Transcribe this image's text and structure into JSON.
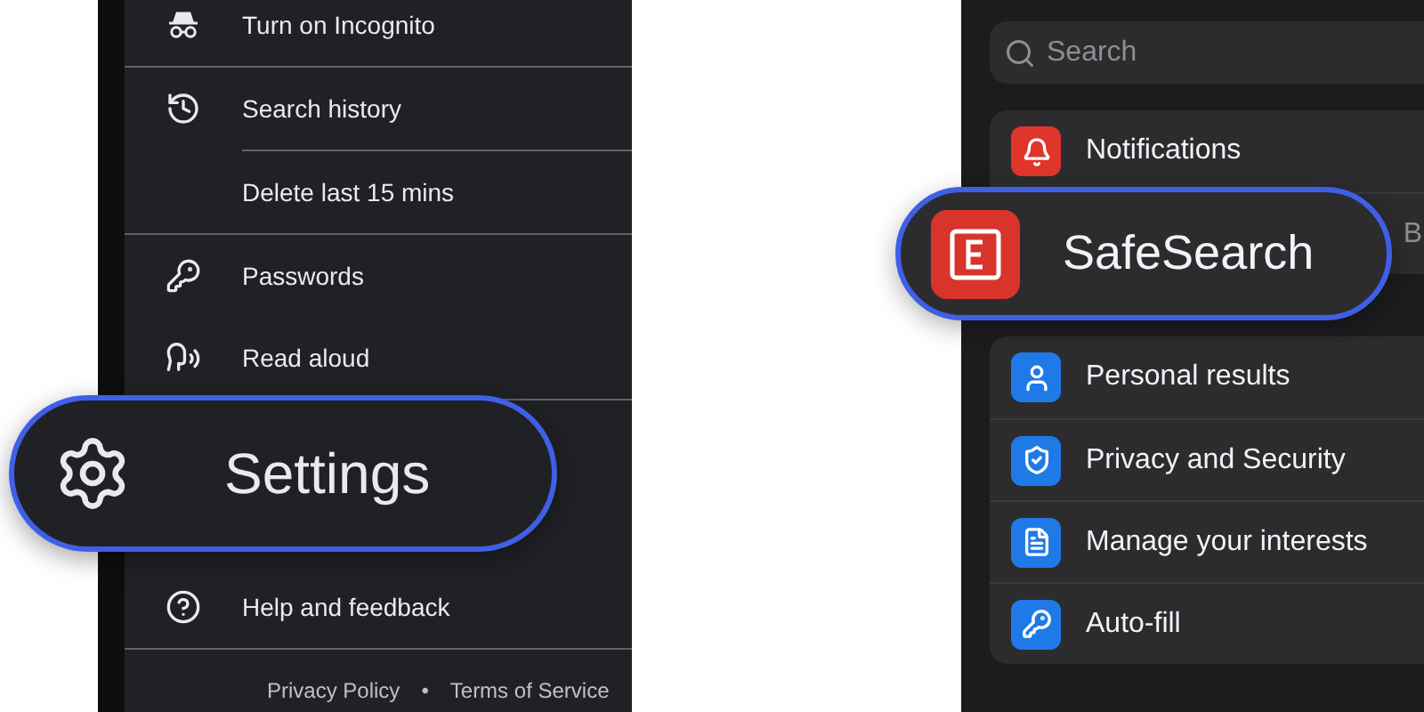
{
  "menu": {
    "items": [
      {
        "kind": "item",
        "label": "Turn on Incognito"
      },
      {
        "kind": "divider"
      },
      {
        "kind": "item",
        "label": "Search history"
      },
      {
        "kind": "subdivider"
      },
      {
        "kind": "sub",
        "label": "Delete last 15 mins"
      },
      {
        "kind": "divider"
      },
      {
        "kind": "item",
        "label": "Passwords"
      },
      {
        "kind": "item",
        "label": "Read aloud"
      },
      {
        "kind": "divider"
      },
      {
        "kind": "covered"
      },
      {
        "kind": "item",
        "label": "Help and feedback"
      },
      {
        "kind": "divider"
      }
    ],
    "footer": {
      "links": [
        "Privacy Policy",
        "Terms of Service"
      ],
      "separator": "•"
    },
    "callout": {
      "label": "Settings"
    }
  },
  "settings_panel": {
    "search": {
      "placeholder": "Search"
    },
    "groups": [
      {
        "rows": [
          {
            "kind": "row",
            "label": "Notifications",
            "color": "#e0352b"
          },
          {
            "kind": "covered",
            "value": "B"
          }
        ]
      },
      {
        "rows": [
          {
            "kind": "row",
            "label": "Personal results",
            "color": "#1f7ae8"
          },
          {
            "kind": "row",
            "label": "Privacy and Security",
            "color": "#1f7ae8"
          },
          {
            "kind": "row",
            "label": "Manage your interests",
            "color": "#1f7ae8"
          },
          {
            "kind": "row",
            "label": "Auto-fill",
            "color": "#1f7ae8"
          }
        ]
      }
    ],
    "callout": {
      "label": "SafeSearch",
      "color": "#d9342b"
    }
  }
}
